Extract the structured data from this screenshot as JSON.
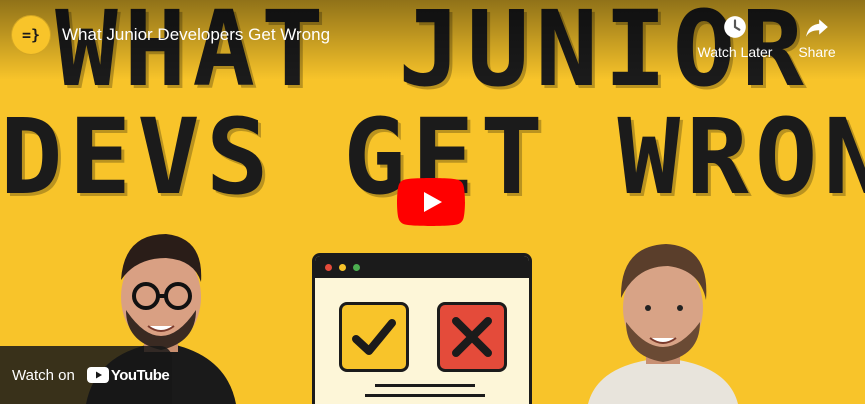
{
  "thumbnail": {
    "line1": "WHAT JUNIOR",
    "line2": "DEVS GET WRONG"
  },
  "header": {
    "channel_avatar_text": "=}",
    "title": "What Junior Developers Get Wrong",
    "watch_later_label": "Watch Later",
    "share_label": "Share"
  },
  "footer": {
    "watch_on_label": "Watch on",
    "youtube_label": "YouTube"
  },
  "colors": {
    "background": "#f8c42a",
    "play_button": "#ff0000",
    "x_box": "#e44b3a",
    "dark": "#1b1b1b"
  },
  "icons": [
    "channel-logo",
    "clock-icon",
    "share-arrow-icon",
    "play-icon",
    "youtube-logo-icon",
    "checkmark-icon",
    "x-mark-icon"
  ]
}
